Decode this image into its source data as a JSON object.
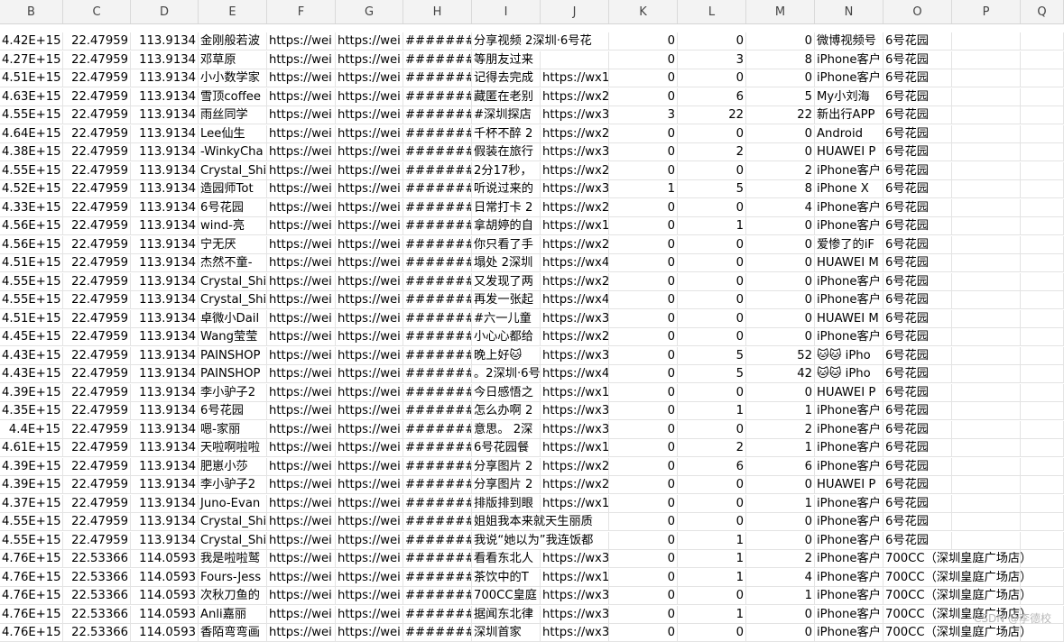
{
  "columns": [
    {
      "letter": "B",
      "align": "num"
    },
    {
      "letter": "C",
      "align": "num"
    },
    {
      "letter": "D",
      "align": "num"
    },
    {
      "letter": "E",
      "align": "txt"
    },
    {
      "letter": "F",
      "align": "txt"
    },
    {
      "letter": "G",
      "align": "txt"
    },
    {
      "letter": "H",
      "align": "txt"
    },
    {
      "letter": "I",
      "align": "txt"
    },
    {
      "letter": "J",
      "align": "txt"
    },
    {
      "letter": "K",
      "align": "num"
    },
    {
      "letter": "L",
      "align": "num"
    },
    {
      "letter": "M",
      "align": "num"
    },
    {
      "letter": "N",
      "align": "txt"
    },
    {
      "letter": "O",
      "align": "txt"
    },
    {
      "letter": "P",
      "align": "txt"
    },
    {
      "letter": "Q",
      "align": "txt"
    }
  ],
  "rows": [
    [
      "4.42E+15",
      "22.47959",
      "113.9134",
      "金刚般若波",
      "https://wei",
      "https://wei",
      "#######",
      "分享视频 2深圳·6号花",
      "",
      "0",
      "0",
      "0",
      "微博视频号",
      "6号花园",
      "",
      ""
    ],
    [
      "4.27E+15",
      "22.47959",
      "113.9134",
      "邓草原",
      "https://wei",
      "https://wei",
      "#######",
      "等朋友过来",
      "",
      "0",
      "3",
      "8",
      "iPhone客户",
      "6号花园",
      "",
      ""
    ],
    [
      "4.51E+15",
      "22.47959",
      "113.9134",
      "小小数学家",
      "https://wei",
      "https://wei",
      "#######",
      "记得去完成",
      "https://wx1",
      "0",
      "0",
      "0",
      "iPhone客户",
      "6号花园",
      "",
      ""
    ],
    [
      "4.63E+15",
      "22.47959",
      "113.9134",
      "雪顶coffee",
      "https://wei",
      "https://wei",
      "#######",
      "藏匿在老别",
      "https://wx2",
      "0",
      "6",
      "5",
      "My小刘海",
      "6号花园",
      "",
      ""
    ],
    [
      "4.55E+15",
      "22.47959",
      "113.9134",
      "雨丝同学",
      "https://wei",
      "https://wei",
      "#######",
      "#深圳探店",
      "https://wx3",
      "3",
      "22",
      "22",
      "新出行APP",
      "6号花园",
      "",
      ""
    ],
    [
      "4.64E+15",
      "22.47959",
      "113.9134",
      "Lee仙生",
      "https://wei",
      "https://wei",
      "#######",
      "千杯不醉 2",
      "https://wx2",
      "0",
      "0",
      "0",
      "Android",
      "6号花园",
      "",
      ""
    ],
    [
      "4.38E+15",
      "22.47959",
      "113.9134",
      "-WinkyCha",
      "https://wei",
      "https://wei",
      "#######",
      "假装在旅行",
      "https://wx3",
      "0",
      "2",
      "0",
      "HUAWEI P",
      "6号花园",
      "",
      ""
    ],
    [
      "4.55E+15",
      "22.47959",
      "113.9134",
      "Crystal_Shi",
      "https://wei",
      "https://wei",
      "#######",
      "2分17秒，",
      "https://wx2",
      "0",
      "0",
      "2",
      "iPhone客户",
      "6号花园",
      "",
      ""
    ],
    [
      "4.52E+15",
      "22.47959",
      "113.9134",
      "造园师Tot",
      "https://wei",
      "https://wei",
      "#######",
      "听说过来的",
      "https://wx3",
      "1",
      "5",
      "8",
      "iPhone X",
      "6号花园",
      "",
      ""
    ],
    [
      "4.33E+15",
      "22.47959",
      "113.9134",
      "6号花园",
      "https://wei",
      "https://wei",
      "#######",
      "日常打卡 2",
      "https://wx2",
      "0",
      "0",
      "4",
      "iPhone客户",
      "6号花园",
      "",
      ""
    ],
    [
      "4.56E+15",
      "22.47959",
      "113.9134",
      "wind-亮",
      "https://wei",
      "https://wei",
      "#######",
      "拿胡婷的自",
      "https://wx1",
      "0",
      "1",
      "0",
      "iPhone客户",
      "6号花园",
      "",
      ""
    ],
    [
      "4.56E+15",
      "22.47959",
      "113.9134",
      "宁无厌",
      "https://wei",
      "https://wei",
      "#######",
      "你只看了手",
      "https://wx2",
      "0",
      "0",
      "0",
      "爱惨了的iF",
      "6号花园",
      "",
      ""
    ],
    [
      "4.51E+15",
      "22.47959",
      "113.9134",
      "杰然不童-",
      "https://wei",
      "https://wei",
      "#######",
      "塌处 2深圳",
      "https://wx4",
      "0",
      "0",
      "0",
      "HUAWEI M",
      "6号花园",
      "",
      ""
    ],
    [
      "4.55E+15",
      "22.47959",
      "113.9134",
      "Crystal_Shi",
      "https://wei",
      "https://wei",
      "#######",
      "又发现了两",
      "https://wx2",
      "0",
      "0",
      "0",
      "iPhone客户",
      "6号花园",
      "",
      ""
    ],
    [
      "4.55E+15",
      "22.47959",
      "113.9134",
      "Crystal_Shi",
      "https://wei",
      "https://wei",
      "#######",
      "再发一张起",
      "https://wx4",
      "0",
      "0",
      "0",
      "iPhone客户",
      "6号花园",
      "",
      ""
    ],
    [
      "4.51E+15",
      "22.47959",
      "113.9134",
      "卓微小Dail",
      "https://wei",
      "https://wei",
      "#######",
      "#六一儿童",
      "https://wx3",
      "0",
      "0",
      "0",
      "HUAWEI M",
      "6号花园",
      "",
      ""
    ],
    [
      "4.45E+15",
      "22.47959",
      "113.9134",
      "Wang莹莹",
      "https://wei",
      "https://wei",
      "#######",
      "小心心都给",
      "https://wx2",
      "0",
      "0",
      "0",
      "iPhone客户",
      "6号花园",
      "",
      ""
    ],
    [
      "4.43E+15",
      "22.47959",
      "113.9134",
      "PAINSHOP",
      "https://wei",
      "https://wei",
      "#######",
      "晚上好🐱 ",
      "https://wx3",
      "0",
      "5",
      "52",
      "🐱🐱 iPho",
      "6号花园",
      "",
      ""
    ],
    [
      "4.43E+15",
      "22.47959",
      "113.9134",
      "PAINSHOP",
      "https://wei",
      "https://wei",
      "#######",
      "。2深圳·6号",
      "https://wx4",
      "0",
      "5",
      "42",
      "🐱🐱 iPho",
      "6号花园",
      "",
      ""
    ],
    [
      "4.39E+15",
      "22.47959",
      "113.9134",
      "李小驴子2",
      "https://wei",
      "https://wei",
      "#######",
      "今日感悟之",
      "https://wx1",
      "0",
      "0",
      "0",
      "HUAWEI P",
      "6号花园",
      "",
      ""
    ],
    [
      "4.35E+15",
      "22.47959",
      "113.9134",
      "6号花园",
      "https://wei",
      "https://wei",
      "#######",
      "怎么办啊 2",
      "https://wx3",
      "0",
      "1",
      "1",
      "iPhone客户",
      "6号花园",
      "",
      ""
    ],
    [
      "4.4E+15",
      "22.47959",
      "113.9134",
      "嗯-家丽",
      "https://wei",
      "https://wei",
      "#######",
      "意思。 2深",
      "https://wx3",
      "0",
      "0",
      "2",
      "iPhone客户",
      "6号花园",
      "",
      ""
    ],
    [
      "4.61E+15",
      "22.47959",
      "113.9134",
      "天啦啊啦啦",
      "https://wei",
      "https://wei",
      "#######",
      "6号花园餐",
      "https://wx1",
      "0",
      "2",
      "1",
      "iPhone客户",
      "6号花园",
      "",
      ""
    ],
    [
      "4.39E+15",
      "22.47959",
      "113.9134",
      "肥崽小莎",
      "https://wei",
      "https://wei",
      "#######",
      "分享图片 2",
      "https://wx2",
      "0",
      "6",
      "6",
      "iPhone客户",
      "6号花园",
      "",
      ""
    ],
    [
      "4.39E+15",
      "22.47959",
      "113.9134",
      "李小驴子2",
      "https://wei",
      "https://wei",
      "#######",
      "分享图片 2",
      "https://wx2",
      "0",
      "0",
      "0",
      "HUAWEI P",
      "6号花园",
      "",
      ""
    ],
    [
      "4.37E+15",
      "22.47959",
      "113.9134",
      "Juno-Evan",
      "https://wei",
      "https://wei",
      "#######",
      "排版排到眼",
      "https://wx1",
      "0",
      "0",
      "1",
      "iPhone客户",
      "6号花园",
      "",
      ""
    ],
    [
      "4.55E+15",
      "22.47959",
      "113.9134",
      "Crystal_Shi",
      "https://wei",
      "https://wei",
      "#######",
      "姐姐我本来就天生丽质",
      "",
      "0",
      "0",
      "0",
      "iPhone客户",
      "6号花园",
      "",
      ""
    ],
    [
      "4.55E+15",
      "22.47959",
      "113.9134",
      "Crystal_Shi",
      "https://wei",
      "https://wei",
      "#######",
      "我说“她以为”我连饭都",
      "",
      "0",
      "1",
      "0",
      "iPhone客户",
      "6号花园",
      "",
      ""
    ],
    [
      "4.76E+15",
      "22.53366",
      "114.0593",
      "我是啦啦鹫",
      "https://wei",
      "https://wei",
      "#######",
      "看看东北人",
      "https://wx3",
      "0",
      "1",
      "2",
      "iPhone客户",
      "700CC（深圳皇庭广场店）",
      "",
      ""
    ],
    [
      "4.76E+15",
      "22.53366",
      "114.0593",
      "Fours-Jess",
      "https://wei",
      "https://wei",
      "#######",
      "茶饮中的T",
      "https://wx1",
      "0",
      "1",
      "4",
      "iPhone客户",
      "700CC（深圳皇庭广场店）",
      "",
      ""
    ],
    [
      "4.76E+15",
      "22.53366",
      "114.0593",
      "次秋刀鱼的",
      "https://wei",
      "https://wei",
      "#######",
      "700CC皇庭",
      "https://wx3",
      "0",
      "0",
      "1",
      "iPhone客户",
      "700CC（深圳皇庭广场店）",
      "",
      ""
    ],
    [
      "4.76E+15",
      "22.53366",
      "114.0593",
      "Anli嘉丽",
      "https://wei",
      "https://wei",
      "#######",
      "据闻东北律",
      "https://wx3",
      "0",
      "1",
      "0",
      "iPhone客户",
      "700CC（深圳皇庭广场店）",
      "",
      ""
    ],
    [
      "4.76E+15",
      "22.53366",
      "114.0593",
      "香陌弯弯画",
      "https://wei",
      "https://wei",
      "#######",
      " 深圳首家",
      "https://wx3",
      "0",
      "0",
      "0",
      "iPhone客户",
      "700CC（深圳皇庭广场店）",
      "",
      ""
    ]
  ],
  "watermark": "CSDN @李德校"
}
